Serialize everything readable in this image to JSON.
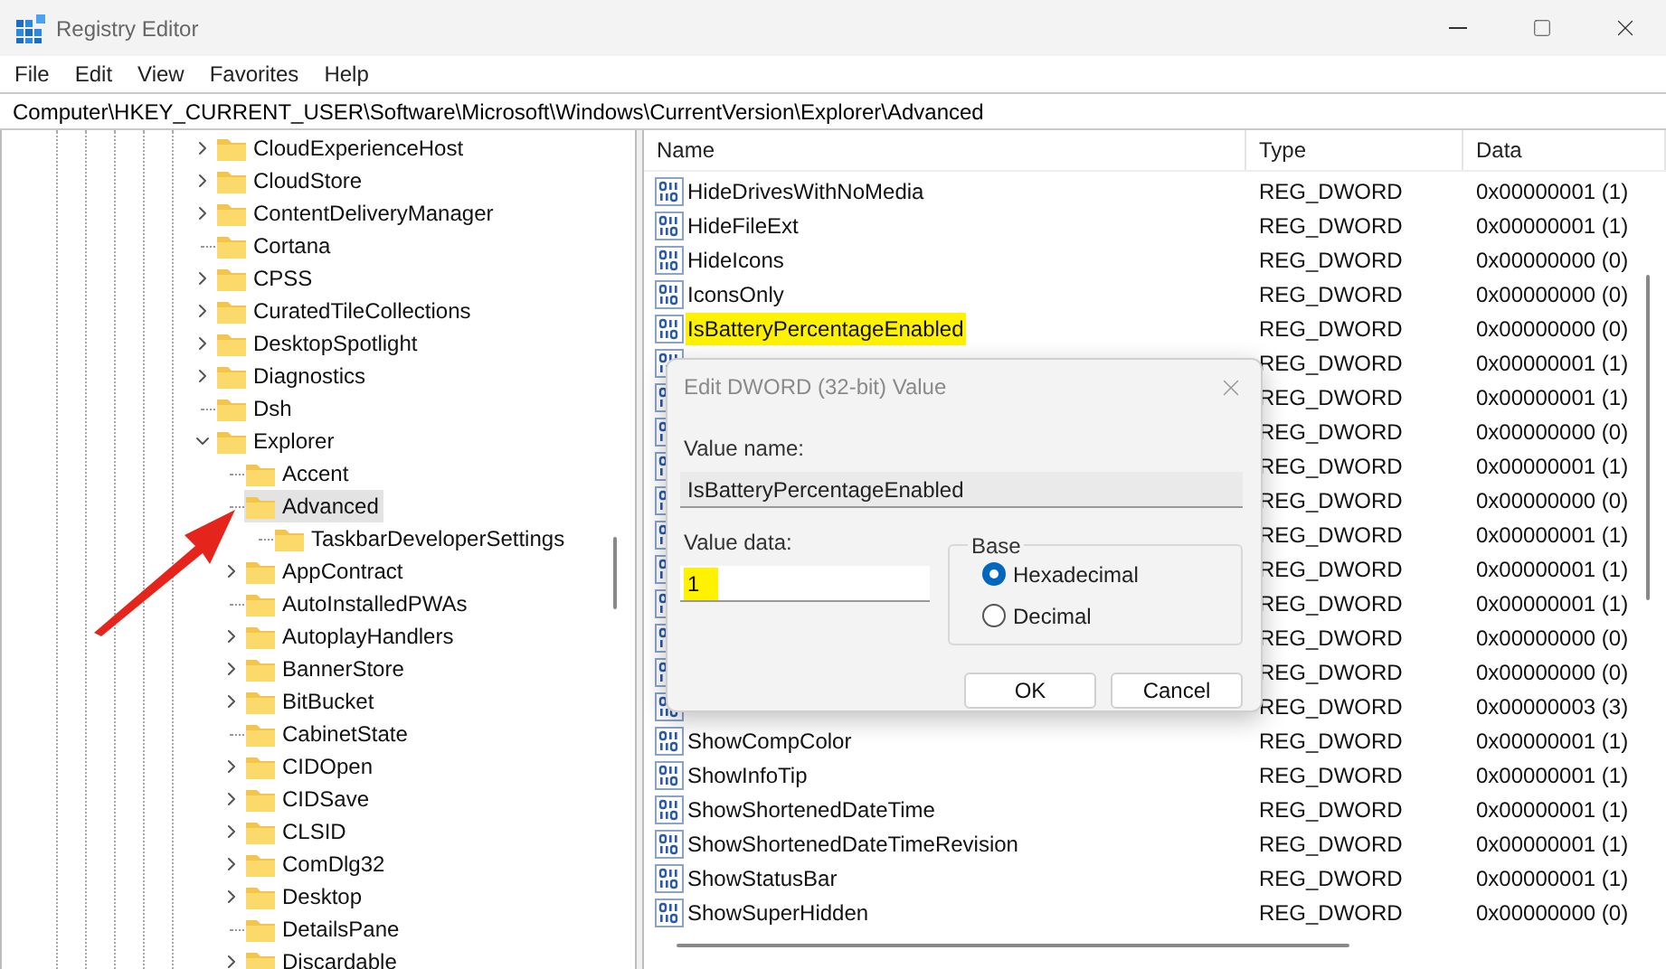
{
  "window": {
    "title": "Registry Editor"
  },
  "menu": [
    "File",
    "Edit",
    "View",
    "Favorites",
    "Help"
  ],
  "address": "Computer\\HKEY_CURRENT_USER\\Software\\Microsoft\\Windows\\CurrentVersion\\Explorer\\Advanced",
  "tree": {
    "items": [
      {
        "label": "CloudExperienceHost",
        "expandable": true,
        "selected": false
      },
      {
        "label": "CloudStore",
        "expandable": true,
        "selected": false
      },
      {
        "label": "ContentDeliveryManager",
        "expandable": true,
        "selected": false
      },
      {
        "label": "Cortana",
        "expandable": false,
        "selected": false
      },
      {
        "label": "CPSS",
        "expandable": true,
        "selected": false
      },
      {
        "label": "CuratedTileCollections",
        "expandable": true,
        "selected": false
      },
      {
        "label": "DesktopSpotlight",
        "expandable": true,
        "selected": false
      },
      {
        "label": "Diagnostics",
        "expandable": true,
        "selected": false
      },
      {
        "label": "Dsh",
        "expandable": false,
        "selected": false
      },
      {
        "label": "Explorer",
        "expandable": true,
        "selected": false,
        "children": [
          {
            "label": "Accent",
            "expandable": false,
            "selected": false
          },
          {
            "label": "Advanced",
            "expandable": false,
            "selected": true,
            "children": [
              {
                "label": "TaskbarDeveloperSettings",
                "expandable": false,
                "selected": false
              }
            ]
          },
          {
            "label": "AppContract",
            "expandable": true,
            "selected": false
          },
          {
            "label": "AutoInstalledPWAs",
            "expandable": false,
            "selected": false
          },
          {
            "label": "AutoplayHandlers",
            "expandable": true,
            "selected": false
          },
          {
            "label": "BannerStore",
            "expandable": true,
            "selected": false
          },
          {
            "label": "BitBucket",
            "expandable": true,
            "selected": false
          },
          {
            "label": "CabinetState",
            "expandable": false,
            "selected": false
          },
          {
            "label": "CIDOpen",
            "expandable": true,
            "selected": false
          },
          {
            "label": "CIDSave",
            "expandable": true,
            "selected": false
          },
          {
            "label": "CLSID",
            "expandable": true,
            "selected": false
          },
          {
            "label": "ComDlg32",
            "expandable": true,
            "selected": false
          },
          {
            "label": "Desktop",
            "expandable": true,
            "selected": false
          },
          {
            "label": "DetailsPane",
            "expandable": false,
            "selected": false
          },
          {
            "label": "Discardable",
            "expandable": true,
            "selected": false
          }
        ]
      }
    ]
  },
  "values": {
    "columns": [
      "Name",
      "Type",
      "Data"
    ],
    "rows": [
      {
        "name": "HideDrivesWithNoMedia",
        "type": "REG_DWORD",
        "data": "0x00000001 (1)",
        "highlighted": false
      },
      {
        "name": "HideFileExt",
        "type": "REG_DWORD",
        "data": "0x00000001 (1)",
        "highlighted": false
      },
      {
        "name": "HideIcons",
        "type": "REG_DWORD",
        "data": "0x00000000 (0)",
        "highlighted": false
      },
      {
        "name": "IconsOnly",
        "type": "REG_DWORD",
        "data": "0x00000000 (0)",
        "highlighted": false
      },
      {
        "name": "IsBatteryPercentageEnabled",
        "type": "REG_DWORD",
        "data": "0x00000000 (0)",
        "highlighted": true
      },
      {
        "type": "REG_DWORD",
        "data": "0x00000001 (1)",
        "highlighted": false
      },
      {
        "type": "REG_DWORD",
        "data": "0x00000001 (1)",
        "highlighted": false
      },
      {
        "type": "REG_DWORD",
        "data": "0x00000000 (0)",
        "highlighted": false
      },
      {
        "type": "REG_DWORD",
        "data": "0x00000001 (1)",
        "highlighted": false
      },
      {
        "type": "REG_DWORD",
        "data": "0x00000000 (0)",
        "highlighted": false
      },
      {
        "type": "REG_DWORD",
        "data": "0x00000001 (1)",
        "highlighted": false
      },
      {
        "type": "REG_DWORD",
        "data": "0x00000001 (1)",
        "highlighted": false
      },
      {
        "type": "REG_DWORD",
        "data": "0x00000001 (1)",
        "highlighted": false
      },
      {
        "type": "REG_DWORD",
        "data": "0x00000000 (0)",
        "highlighted": false
      },
      {
        "type": "REG_DWORD",
        "data": "0x00000000 (0)",
        "highlighted": false
      },
      {
        "type": "REG_DWORD",
        "data": "0x00000003 (3)",
        "highlighted": false
      },
      {
        "name": "ShowCompColor",
        "type": "REG_DWORD",
        "data": "0x00000001 (1)",
        "highlighted": false
      },
      {
        "name": "ShowInfoTip",
        "type": "REG_DWORD",
        "data": "0x00000001 (1)",
        "highlighted": false
      },
      {
        "name": "ShowShortenedDateTime",
        "type": "REG_DWORD",
        "data": "0x00000001 (1)",
        "highlighted": false
      },
      {
        "name": "ShowShortenedDateTimeRevision",
        "type": "REG_DWORD",
        "data": "0x00000001 (1)",
        "highlighted": false
      },
      {
        "name": "ShowStatusBar",
        "type": "REG_DWORD",
        "data": "0x00000001 (1)",
        "highlighted": false
      },
      {
        "name": "ShowSuperHidden",
        "type": "REG_DWORD",
        "data": "0x00000000 (0)",
        "highlighted": false
      }
    ]
  },
  "dialog": {
    "title": "Edit DWORD (32-bit) Value",
    "value_name_label": "Value name:",
    "value_name": "IsBatteryPercentageEnabled",
    "value_data_label": "Value data:",
    "value_data": "1",
    "value_data_highlighted": true,
    "base_label": "Base",
    "base_options": [
      {
        "label": "Hexadecimal",
        "selected": true
      },
      {
        "label": "Decimal",
        "selected": false
      }
    ],
    "buttons": [
      "OK",
      "Cancel"
    ]
  }
}
